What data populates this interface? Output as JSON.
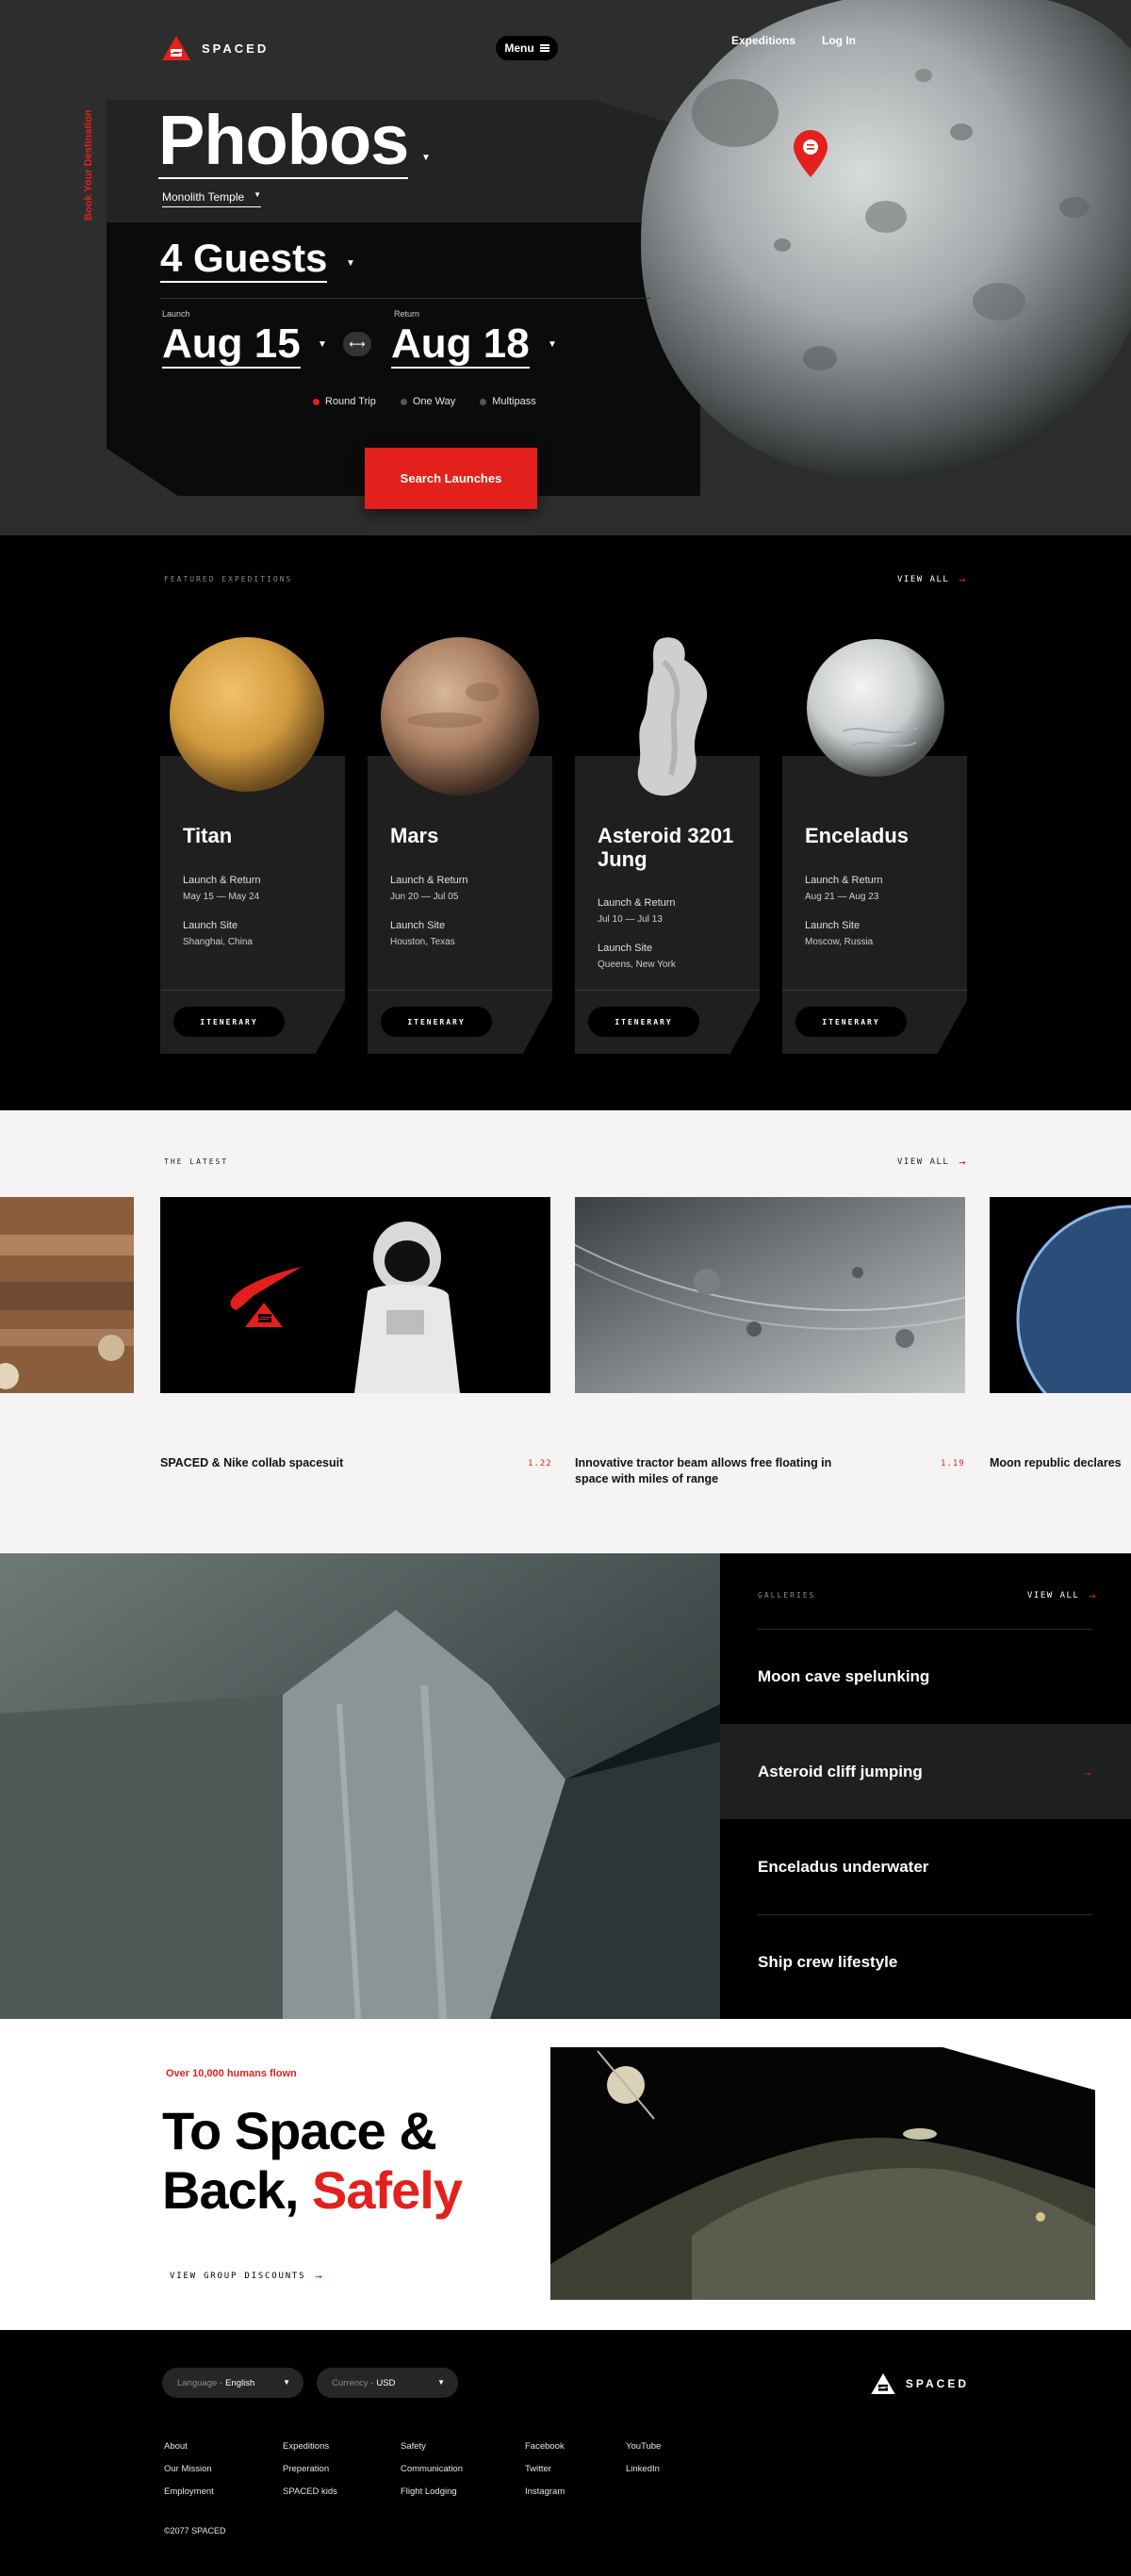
{
  "brand": {
    "name": "SPACED",
    "accent": "#e3201b"
  },
  "nav": {
    "expeditions": "Expeditions",
    "login": "Log In",
    "menu": "Menu"
  },
  "hero": {
    "side_label": "Book Your Destination",
    "destination": "Phobos",
    "sub_destination": "Monolith Temple",
    "guests": "4 Guests",
    "launch_label": "Launch",
    "launch_date": "Aug 15",
    "return_label": "Return",
    "return_date": "Aug 18",
    "trip_options": [
      "Round Trip",
      "One Way",
      "Multipass"
    ],
    "selected_trip": "Round Trip",
    "search_label": "Search Launches"
  },
  "featured": {
    "kicker": "FEATURED EXPEDITIONS",
    "view_all": "VIEW ALL",
    "cards": [
      {
        "title": "Titan",
        "lr_label": "Launch & Return",
        "lr_dates": "May 15 — May 24",
        "site_label": "Launch Site",
        "site": "Shanghai, China",
        "button": "ITENERARY"
      },
      {
        "title": "Mars",
        "lr_label": "Launch & Return",
        "lr_dates": "Jun 20 — Jul 05",
        "site_label": "Launch Site",
        "site": "Houston, Texas",
        "button": "ITENERARY"
      },
      {
        "title": "Asteroid 3201 Jung",
        "lr_label": "Launch & Return",
        "lr_dates": "Jul 10 — Jul 13",
        "site_label": "Launch Site",
        "site": "Queens, New York",
        "button": "ITENERARY"
      },
      {
        "title": "Enceladus",
        "lr_label": "Launch & Return",
        "lr_dates": "Aug 21 — Aug 23",
        "site_label": "Launch Site",
        "site": "Moscow, Russia",
        "button": "ITENERARY"
      }
    ]
  },
  "latest": {
    "kicker": "THE LATEST",
    "view_all": "VIEW ALL",
    "items": [
      {
        "title": "SPACED & Nike collab spacesuit",
        "num": "1.22"
      },
      {
        "title": "Innovative tractor beam allows free floating in space with miles of range",
        "num": "1.19"
      },
      {
        "title": "Moon republic declares",
        "num": ""
      }
    ]
  },
  "galleries": {
    "kicker": "GALLERIES",
    "view_all": "VIEW ALL",
    "items": [
      "Moon cave spelunking",
      "Asteroid cliff jumping",
      "Enceladus underwater",
      "Ship crew lifestyle"
    ],
    "active_index": 1
  },
  "safety": {
    "kicker": "Over 10,000 humans flown",
    "headline_part1": "To Space &",
    "headline_part2": "Back,",
    "headline_accent": "Safely",
    "link": "VIEW GROUP DISCOUNTS"
  },
  "footer": {
    "language_label": "Language -",
    "language_value": "English",
    "currency_label": "Currency -",
    "currency_value": "USD",
    "col1": [
      "About",
      "Our Mission",
      "Employment"
    ],
    "col2": [
      "Expeditions",
      "Preperation",
      "SPACED kids"
    ],
    "col3": [
      "Safety",
      "Communication",
      "Flight Lodging"
    ],
    "col4": [
      "Facebook",
      "Twitter",
      "Instagram"
    ],
    "col5": [
      "YouTube",
      "LinkedIn"
    ],
    "copyright": "©2077 SPACED"
  }
}
